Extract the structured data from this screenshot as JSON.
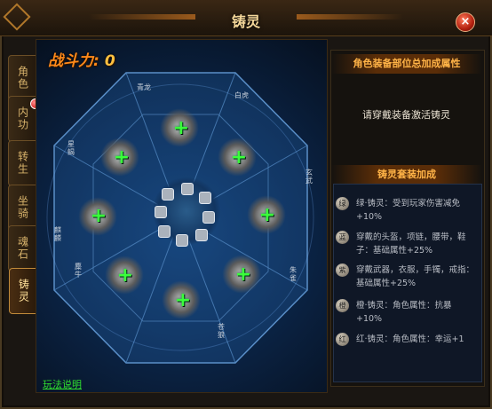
{
  "window": {
    "title": "铸灵",
    "close_label": "×"
  },
  "tabs": [
    {
      "label": "角色"
    },
    {
      "label": "内功"
    },
    {
      "label": "转生"
    },
    {
      "label": "坐骑"
    },
    {
      "label": "魂石"
    },
    {
      "label": "铸灵"
    }
  ],
  "power": {
    "label": "战斗力:",
    "value": "0"
  },
  "wheel": {
    "labels": [
      "青龙",
      "白虎",
      "玄武",
      "朱雀",
      "苍狼",
      "麋牛",
      "麒麟",
      "星蝎"
    ],
    "add_symbol": "+"
  },
  "right": {
    "header1": "角色装备部位总加成属性",
    "hint": "请穿戴装备激活铸灵",
    "header2": "铸灵套装加成",
    "sets": [
      {
        "badge": "绿",
        "text": "绿·铸灵：受到玩家伤害减免+10%"
      },
      {
        "badge": "蓝",
        "text": "穿戴的头盔，项链，腰带，鞋子：基础属性+25%"
      },
      {
        "badge": "紫",
        "text": "穿戴武器，衣服，手镯，戒指：基础属性+25%"
      },
      {
        "badge": "橙",
        "text": "橙·铸灵：角色属性：抗暴+10%"
      },
      {
        "badge": "红",
        "text": "红·铸灵：角色属性：幸运+1"
      }
    ]
  },
  "help": {
    "label": "玩法说明"
  },
  "colors": {
    "accent": "#ff8a1a",
    "title": "#f4d79a",
    "help": "#2fe02f",
    "plus": "#3aff3a"
  }
}
